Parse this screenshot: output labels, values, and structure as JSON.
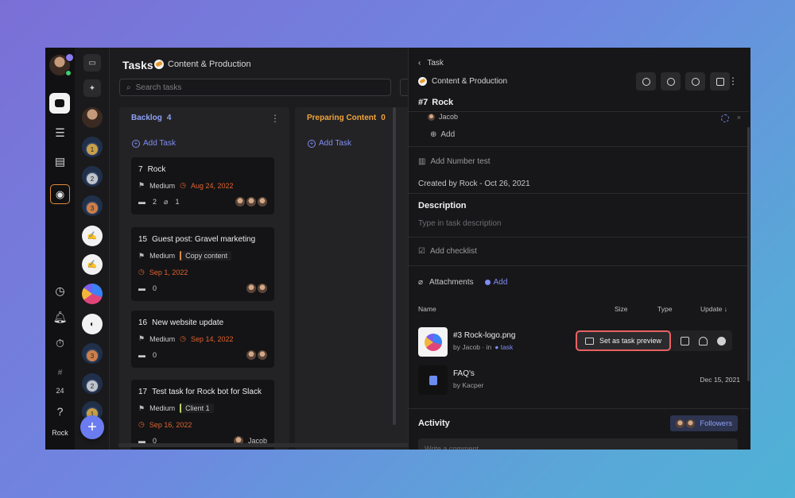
{
  "rail": {
    "counter": "24",
    "user_name": "Rock"
  },
  "board": {
    "title": "Tasks",
    "project": "Content & Production",
    "search_placeholder": "Search tasks",
    "columns": [
      {
        "name": "Backlog",
        "count": "4",
        "color": "#8ea0f5",
        "add_label": "Add Task"
      },
      {
        "name": "Preparing Content",
        "count": "0",
        "color": "#f0a43a",
        "add_label": "Add Task"
      }
    ],
    "cards": [
      {
        "num": "7",
        "title": "Rock",
        "priority": "Medium",
        "due": "Aug 24, 2022",
        "comments": "2",
        "attachments": "1"
      },
      {
        "num": "15",
        "title": "Guest post: Gravel marketing",
        "priority": "Medium",
        "tag": "Copy content",
        "due": "Sep 1, 2022",
        "comments": "0"
      },
      {
        "num": "16",
        "title": "New website update",
        "priority": "Medium",
        "due": "Sep 14, 2022",
        "comments": "0"
      },
      {
        "num": "17",
        "title": "Test task for Rock bot for Slack",
        "priority": "Medium",
        "tag": "Client 1",
        "due": "Sep 16, 2022",
        "comments": "0",
        "assignee": "Jacob"
      }
    ]
  },
  "panel": {
    "back_label": "Task",
    "project": "Content & Production",
    "task_id": "#7",
    "task_title": "Rock",
    "assignee": "Jacob",
    "add_label": "Add",
    "number_field": "Add Number test",
    "created": "Created by Rock - Oct 26, 2021",
    "description_title": "Description",
    "description_placeholder": "Type in task description",
    "checklist_label": "Add checklist",
    "attachments_label": "Attachments",
    "attachments_add": "Add",
    "table_headers": {
      "name": "Name",
      "size": "Size",
      "type": "Type",
      "update": "Update"
    },
    "files": [
      {
        "id": "#3",
        "name": "Rock-logo.png",
        "by": "by Jacob · in",
        "link": "task"
      },
      {
        "name": "FAQ's",
        "by": "by Kacper",
        "date": "Dec 15, 2021"
      }
    ],
    "preview_button": "Set as task preview",
    "activity_title": "Activity",
    "followers_label": "Followers",
    "comment_placeholder": "Write a comment"
  }
}
